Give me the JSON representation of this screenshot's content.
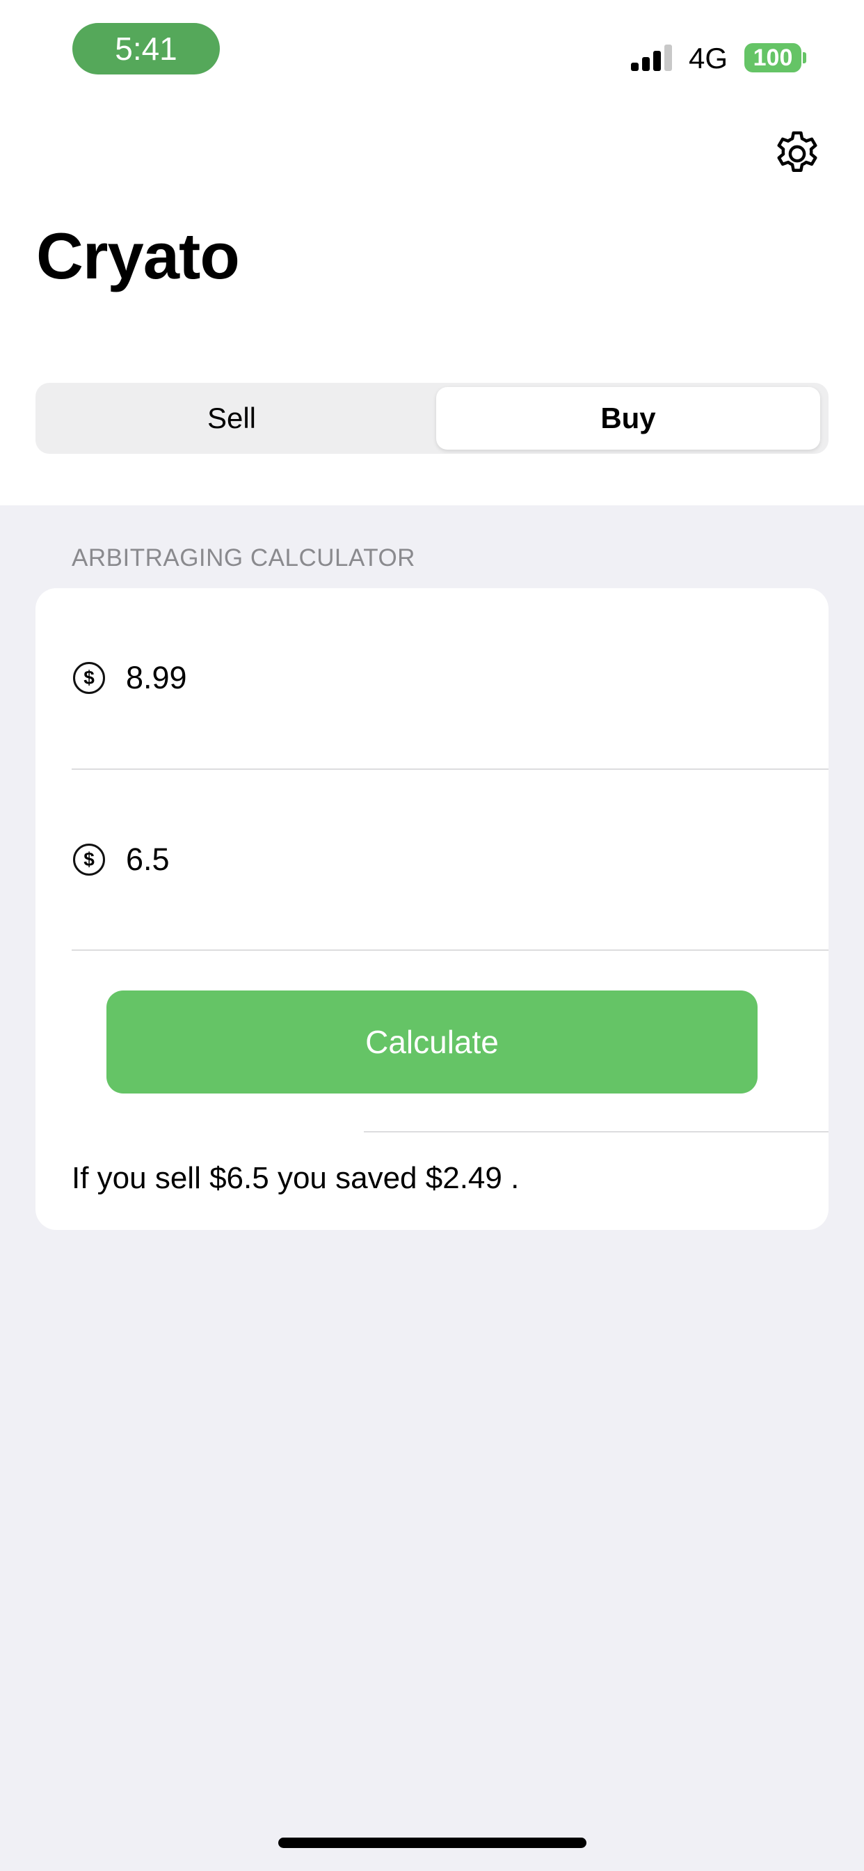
{
  "status_bar": {
    "time": "5:41",
    "network": "4G",
    "battery": "100",
    "accent_color": "#55a85a",
    "battery_color": "#65c466"
  },
  "header": {
    "settings_icon": "gear-icon",
    "title": "Cryato"
  },
  "segmented_control": {
    "options": [
      "Sell",
      "Buy"
    ],
    "selected": "Buy"
  },
  "calculator": {
    "section_header": "ARBITRAGING CALCULATOR",
    "field_icon": "dollar-circle-icon",
    "fields": [
      {
        "value": "8.99"
      },
      {
        "value": "6.5"
      }
    ],
    "button_label": "Calculate",
    "button_color": "#65c466",
    "result": "If you sell $6.5 you saved $2.49 ."
  }
}
